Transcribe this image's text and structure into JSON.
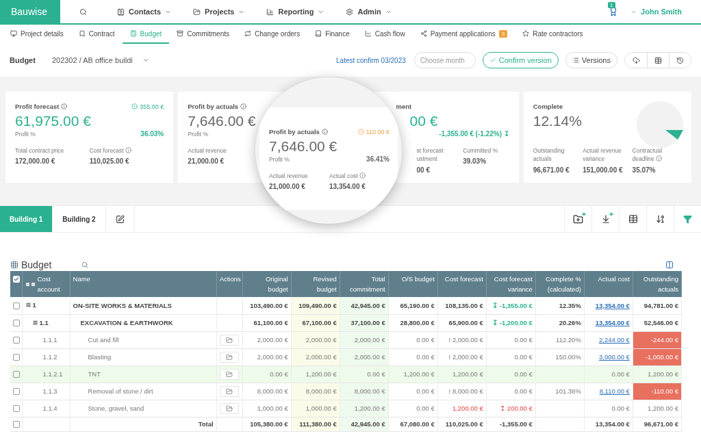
{
  "app": {
    "logo": "Bauwise",
    "menu": [
      {
        "label": "Contacts"
      },
      {
        "label": "Projects"
      },
      {
        "label": "Reporting"
      },
      {
        "label": "Admin"
      }
    ],
    "notifications": "1",
    "user": "John Smith"
  },
  "tabs": [
    {
      "label": "Project details",
      "selected": false
    },
    {
      "label": "Contract",
      "selected": false
    },
    {
      "label": "Budget",
      "selected": true
    },
    {
      "label": "Commitments",
      "selected": false
    },
    {
      "label": "Change orders",
      "selected": false
    },
    {
      "label": "Finance",
      "selected": false
    },
    {
      "label": "Cash flow",
      "selected": false
    },
    {
      "label": "Payment applications",
      "selected": false,
      "badge": "3"
    },
    {
      "label": "Rate contractors",
      "selected": false
    }
  ],
  "budget_bar": {
    "label": "Budget",
    "project": "202302 / AB office buildi",
    "confirm_link": "Latest confirm 03/2023",
    "month": {
      "placeholder": "Choose month"
    },
    "confirm_button": "Confirm version",
    "versions_button": "Versions"
  },
  "cards": [
    {
      "kind": "standard",
      "title": "Profit forecast",
      "info": true,
      "badge": {
        "text": "355.00 €",
        "kind": "good"
      },
      "value": "61,975.00 €",
      "accent": true,
      "sub_label": "Profit %",
      "sub_value": "36.03%",
      "sub_accent": true,
      "stats": [
        {
          "label": "Total contract price",
          "value": "172,000.00 €",
          "info": false
        },
        {
          "label": "Cost forecast",
          "value": "110,025.00 €",
          "info": true
        }
      ]
    },
    {
      "kind": "standard",
      "title": "Profit by actuals",
      "info": true,
      "value": "7,646.00 €",
      "accent": false,
      "sub_label": "Profit %",
      "stats": [
        {
          "label": "Actual revenue",
          "value": "21,000.00 €",
          "info": false
        }
      ]
    },
    {
      "kind": "clipped",
      "title": "ment",
      "info": false,
      "value": "00 €",
      "accent": true,
      "sub_value": "-1,355.00 € (-1.22%) ↧",
      "sub_accent": true,
      "stats": [
        {
          "label": "st forecast ustment",
          "value": "00 €",
          "info": false
        },
        {
          "label": "Committed %",
          "value": "39.03%",
          "info": false
        }
      ]
    },
    {
      "kind": "progress",
      "title": "Complete",
      "info": false,
      "value": "12.14%",
      "accent": false,
      "stats": [
        {
          "label": "Outstanding actuals",
          "value": "96,671.00 €",
          "info": false
        },
        {
          "label": "Actual revenue variance",
          "value": "151,000.00 €",
          "info": false
        },
        {
          "label": "Contractual deadline",
          "value": "35.07%",
          "info": true
        }
      ]
    }
  ],
  "magnifier": {
    "title": "Profit by actuals",
    "info": true,
    "badge": {
      "text": "110.00 €",
      "kind": "warn"
    },
    "value": "7,646.00 €",
    "accent": false,
    "sub_label": "Profit %",
    "sub_value": "36.41%",
    "sub_accent": false,
    "stats": [
      {
        "label": "Actual revenue",
        "value": "21,000.00 €",
        "info": false
      },
      {
        "label": "Actual cost",
        "value": "13,354.00 €",
        "info": true
      }
    ]
  },
  "buildings": [
    {
      "label": "Building 1",
      "selected": true
    },
    {
      "label": "Building 2",
      "selected": false
    }
  ],
  "table": {
    "title": "Budget",
    "columns": [
      {
        "kind": "select",
        "checked": true
      },
      {
        "label": "Cost account",
        "kind": "account"
      },
      {
        "label": "Name",
        "kind": "name"
      },
      {
        "label": "Actions",
        "kind": "actions"
      },
      {
        "label": "Original budget",
        "kind": "number"
      },
      {
        "label": "Revised budget",
        "kind": "number",
        "color": "#fbfbe9"
      },
      {
        "label": "Total commitment",
        "kind": "number",
        "color": "#effaef"
      },
      {
        "label": "O/S budget",
        "kind": "number"
      },
      {
        "label": "Cost forecast",
        "kind": "number"
      },
      {
        "label": "Cost forecast variance",
        "kind": "number"
      },
      {
        "label": "Complete % (calculated)",
        "kind": "number"
      },
      {
        "label": "Actual cost",
        "kind": "number"
      },
      {
        "label": "Outstanding actuals",
        "kind": "number"
      }
    ],
    "rows": [
      {
        "kind": "group",
        "expanded": true,
        "highlighted": false,
        "cells": [
          {
            "kind": "checkbox",
            "checked": false
          },
          {
            "kind": "account",
            "text": "1"
          },
          {
            "kind": "name",
            "text": "ON-SITE WORKS & MATERIALS"
          },
          {
            "kind": "empty"
          },
          {
            "kind": "plain",
            "text": "103,490.00 €"
          },
          {
            "kind": "plain",
            "text": "109,490.00 €"
          },
          {
            "kind": "plain",
            "text": "42,945.00 €"
          },
          {
            "kind": "plain",
            "text": "65,190.00 €"
          },
          {
            "kind": "plain",
            "text": "108,135.00 €"
          },
          {
            "kind": "good",
            "text": "↧ -1,355.00 €"
          },
          {
            "kind": "plain",
            "text": "12.35%"
          },
          {
            "kind": "link",
            "text": "13,354.00 €"
          },
          {
            "kind": "plain",
            "text": "94,781.00 €"
          }
        ],
        "children": [
          {
            "kind": "group",
            "expanded": true,
            "highlighted": false,
            "cells": [
              {
                "kind": "checkbox",
                "checked": false
              },
              {
                "kind": "account",
                "text": "1.1"
              },
              {
                "kind": "name",
                "text": "EXCAVATION & EARTHWORK"
              },
              {
                "kind": "empty"
              },
              {
                "kind": "plain",
                "text": "61,100.00 €"
              },
              {
                "kind": "plain",
                "text": "67,100.00 €"
              },
              {
                "kind": "plain",
                "text": "37,100.00 €"
              },
              {
                "kind": "plain",
                "text": "28,800.00 €"
              },
              {
                "kind": "plain",
                "text": "65,900.00 €"
              },
              {
                "kind": "good",
                "text": "↧ -1,200.00 €"
              },
              {
                "kind": "plain",
                "text": "20.26%"
              },
              {
                "kind": "link",
                "text": "13,354.00 €"
              },
              {
                "kind": "plain",
                "text": "52,546.00 €"
              }
            ],
            "children": [
              {
                "kind": "item",
                "highlighted": false,
                "cells": [
                  {
                    "kind": "checkbox",
                    "checked": false
                  },
                  {
                    "kind": "account",
                    "text": "1.1.1"
                  },
                  {
                    "kind": "name",
                    "text": "Cut and fill"
                  },
                  {
                    "kind": "action"
                  },
                  {
                    "kind": "plain",
                    "text": "2,000.00 €"
                  },
                  {
                    "kind": "plain",
                    "text": "2,000.00 €"
                  },
                  {
                    "kind": "plain",
                    "text": "2,000.00 €"
                  },
                  {
                    "kind": "plain",
                    "text": "0.00 €"
                  },
                  {
                    "kind": "plain",
                    "text": "! 2,000.00 €"
                  },
                  {
                    "kind": "plain",
                    "text": "0.00 €"
                  },
                  {
                    "kind": "plain",
                    "text": "112.20%"
                  },
                  {
                    "kind": "link",
                    "text": "2,244.00 €"
                  },
                  {
                    "kind": "alert",
                    "text": "-244.00 €"
                  }
                ]
              },
              {
                "kind": "item",
                "highlighted": false,
                "cells": [
                  {
                    "kind": "checkbox",
                    "checked": false
                  },
                  {
                    "kind": "account",
                    "text": "1.1.2"
                  },
                  {
                    "kind": "name",
                    "text": "Blasting"
                  },
                  {
                    "kind": "action"
                  },
                  {
                    "kind": "plain",
                    "text": "2,000.00 €"
                  },
                  {
                    "kind": "plain",
                    "text": "2,000.00 €"
                  },
                  {
                    "kind": "plain",
                    "text": "2,000.00 €"
                  },
                  {
                    "kind": "plain",
                    "text": "0.00 €"
                  },
                  {
                    "kind": "plain",
                    "text": "! 2,000.00 €"
                  },
                  {
                    "kind": "plain",
                    "text": "0.00 €"
                  },
                  {
                    "kind": "plain",
                    "text": "150.00%"
                  },
                  {
                    "kind": "link",
                    "text": "3,000.00 €"
                  },
                  {
                    "kind": "alert",
                    "text": "-1,000.00 €"
                  }
                ]
              },
              {
                "kind": "item",
                "highlighted": true,
                "cells": [
                  {
                    "kind": "checkbox",
                    "checked": false
                  },
                  {
                    "kind": "account",
                    "text": "1.1.2.1"
                  },
                  {
                    "kind": "name",
                    "text": "TNT"
                  },
                  {
                    "kind": "action"
                  },
                  {
                    "kind": "plain",
                    "text": "0.00 €"
                  },
                  {
                    "kind": "plain",
                    "text": "1,200.00 €"
                  },
                  {
                    "kind": "plain",
                    "text": "0.00 €"
                  },
                  {
                    "kind": "plain",
                    "text": "1,200.00 €"
                  },
                  {
                    "kind": "plain",
                    "text": "1,200.00 €"
                  },
                  {
                    "kind": "plain",
                    "text": "0.00 €"
                  },
                  {
                    "kind": "empty"
                  },
                  {
                    "kind": "plain",
                    "text": "0.00 €"
                  },
                  {
                    "kind": "plain",
                    "text": "1,200.00 €"
                  }
                ]
              },
              {
                "kind": "item",
                "highlighted": false,
                "cells": [
                  {
                    "kind": "checkbox",
                    "checked": false
                  },
                  {
                    "kind": "account",
                    "text": "1.1.3"
                  },
                  {
                    "kind": "name",
                    "text": "Removal of stone / dirt"
                  },
                  {
                    "kind": "action"
                  },
                  {
                    "kind": "plain",
                    "text": "8,000.00 €"
                  },
                  {
                    "kind": "plain",
                    "text": "8,000.00 €"
                  },
                  {
                    "kind": "plain",
                    "text": "8,000.00 €"
                  },
                  {
                    "kind": "plain",
                    "text": "0.00 €"
                  },
                  {
                    "kind": "plain",
                    "text": "! 8,000.00 €"
                  },
                  {
                    "kind": "plain",
                    "text": "0.00 €"
                  },
                  {
                    "kind": "plain",
                    "text": "101.38%"
                  },
                  {
                    "kind": "link",
                    "text": "8,110.00 €"
                  },
                  {
                    "kind": "alert",
                    "text": "-110.00 €"
                  }
                ]
              },
              {
                "kind": "item",
                "highlighted": false,
                "cells": [
                  {
                    "kind": "checkbox",
                    "checked": false
                  },
                  {
                    "kind": "account",
                    "text": "1.1.4"
                  },
                  {
                    "kind": "name",
                    "text": "Stone, gravel, sand"
                  },
                  {
                    "kind": "action"
                  },
                  {
                    "kind": "plain",
                    "text": "1,000.00 €"
                  },
                  {
                    "kind": "plain",
                    "text": "1,000.00 €"
                  },
                  {
                    "kind": "plain",
                    "text": "1,200.00 €"
                  },
                  {
                    "kind": "plain",
                    "text": "0.00 €"
                  },
                  {
                    "kind": "bad",
                    "text": "1,200.00 €"
                  },
                  {
                    "kind": "bad",
                    "text": "↥ 200.00 €"
                  },
                  {
                    "kind": "empty"
                  },
                  {
                    "kind": "plain",
                    "text": "0.00 €"
                  },
                  {
                    "kind": "plain",
                    "text": "1,200.00 €"
                  }
                ]
              }
            ]
          }
        ]
      },
      {
        "kind": "total",
        "highlighted": false,
        "cells": [
          {
            "kind": "checkbox",
            "checked": false
          },
          {
            "kind": "empty"
          },
          {
            "kind": "total",
            "text": "Total"
          },
          {
            "kind": "empty"
          },
          {
            "kind": "plain",
            "text": "105,380.00 €"
          },
          {
            "kind": "plain",
            "text": "111,380.00 €"
          },
          {
            "kind": "plain",
            "text": "42,945.00 €"
          },
          {
            "kind": "plain",
            "text": "67,080.00 €"
          },
          {
            "kind": "plain",
            "text": "110,025.00 €"
          },
          {
            "kind": "plain",
            "text": "-1,355.00 €"
          },
          {
            "kind": "empty"
          },
          {
            "kind": "plain",
            "text": "13,354.00 €"
          },
          {
            "kind": "plain",
            "text": "96,671.00 €"
          }
        ]
      }
    ]
  }
}
